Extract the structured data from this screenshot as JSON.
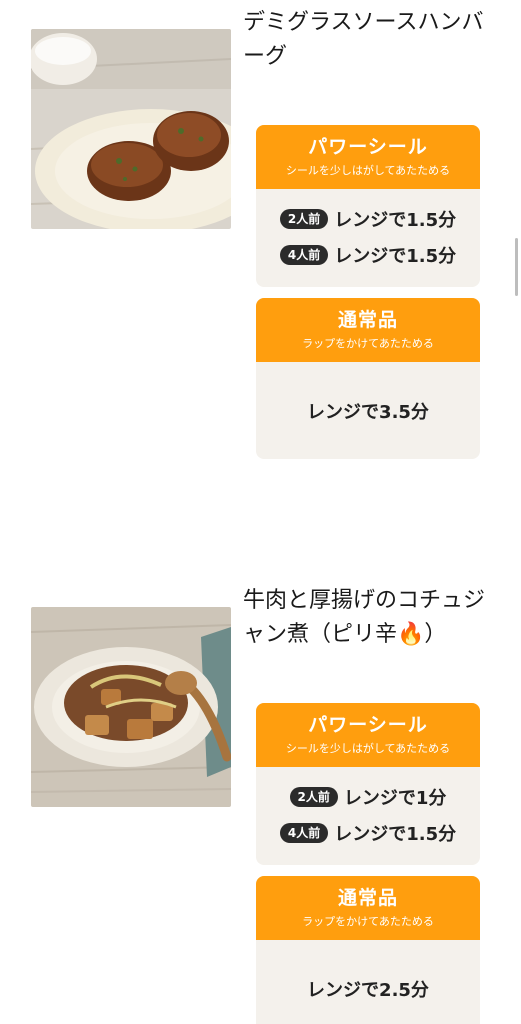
{
  "recipes": [
    {
      "title": "デミグラスソースハンバーグ",
      "photo": "hamburg-steak-photo",
      "power_seal": {
        "title": "パワーシール",
        "subtitle": "シールを少しはがしてあたためる",
        "rows": [
          {
            "serving": "2人前",
            "time": "レンジで1.5分"
          },
          {
            "serving": "4人前",
            "time": "レンジで1.5分"
          }
        ]
      },
      "normal": {
        "title": "通常品",
        "subtitle": "ラップをかけてあたためる",
        "time": "レンジで3.5分"
      }
    },
    {
      "title": "牛肉と厚揚げのコチュジャン煮（ピリ辛🔥）",
      "photo": "beef-atsuage-photo",
      "power_seal": {
        "title": "パワーシール",
        "subtitle": "シールを少しはがしてあたためる",
        "rows": [
          {
            "serving": "2人前",
            "time": "レンジで1分"
          },
          {
            "serving": "4人前",
            "time": "レンジで1.5分"
          }
        ]
      },
      "normal": {
        "title": "通常品",
        "subtitle": "ラップをかけてあたためる",
        "time": "レンジで2.5分"
      }
    }
  ],
  "colors": {
    "accent": "#ff9e0e",
    "card_bg": "#f4f1ec",
    "badge_bg": "#2b2b2b"
  }
}
